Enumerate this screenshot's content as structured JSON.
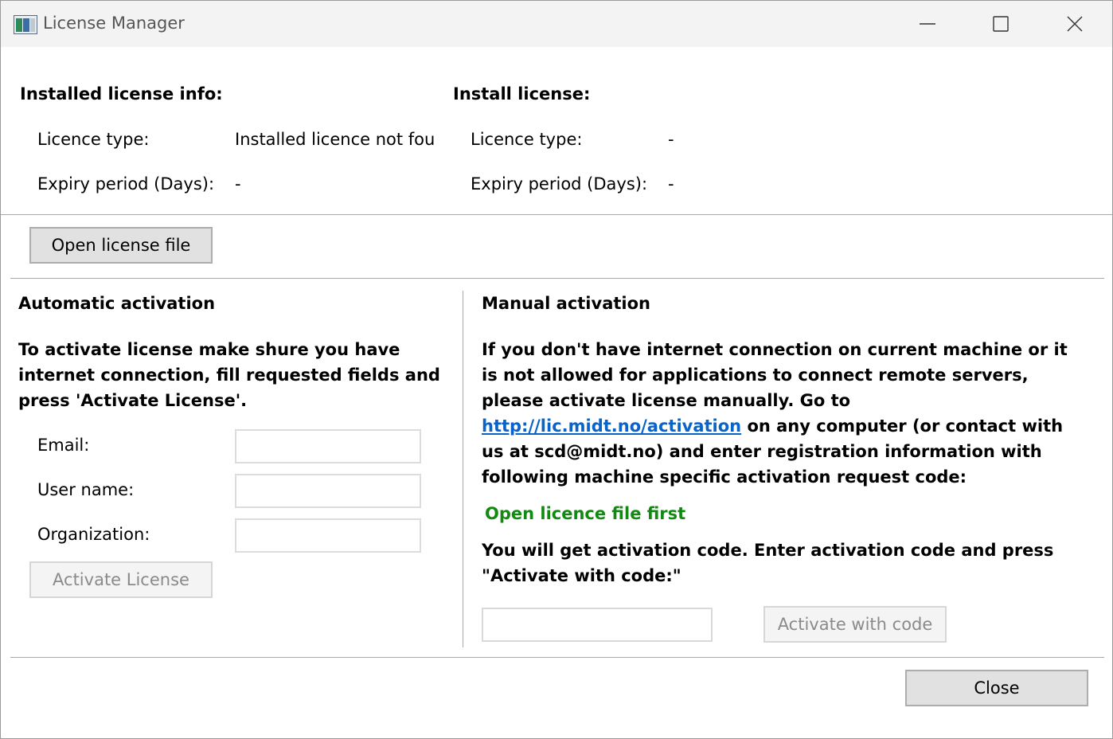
{
  "window": {
    "title": "License Manager"
  },
  "installed": {
    "heading": "Installed license info:",
    "type_label": "Licence type:",
    "type_value": "Installed licence not fou",
    "expiry_label": "Expiry period (Days):",
    "expiry_value": "-"
  },
  "install": {
    "heading": "Install license:",
    "type_label": "Licence type:",
    "type_value": "-",
    "expiry_label": "Expiry period (Days):",
    "expiry_value": "-"
  },
  "open_file_button": "Open license file",
  "automatic": {
    "heading": "Automatic activation",
    "instructions": "To activate license make shure you have internet connection, fill requested fields and press 'Activate License'.",
    "email_label": "Email:",
    "email_value": "",
    "username_label": "User name:",
    "username_value": "",
    "organization_label": "Organization:",
    "organization_value": "",
    "activate_button": "Activate License"
  },
  "manual": {
    "heading": "Manual activation",
    "instructions_part1": "If you don't have internet connection on current machine or it is not allowed for applications to connect remote servers, please activate license manually. Go to ",
    "link_text": "http://lic.midt.no/activation",
    "instructions_part2": " on any computer (or contact with us at scd@midt.no) and enter registration information with following machine specific activation request code:",
    "request_code_status": "Open licence file first",
    "code_instructions": "You will get activation code. Enter activation code and press \"Activate with code:\"",
    "code_value": "",
    "activate_code_button": "Activate with code"
  },
  "close_button": "Close",
  "colors": {
    "status_green": "#128a12",
    "link_blue": "#0a64c8"
  }
}
